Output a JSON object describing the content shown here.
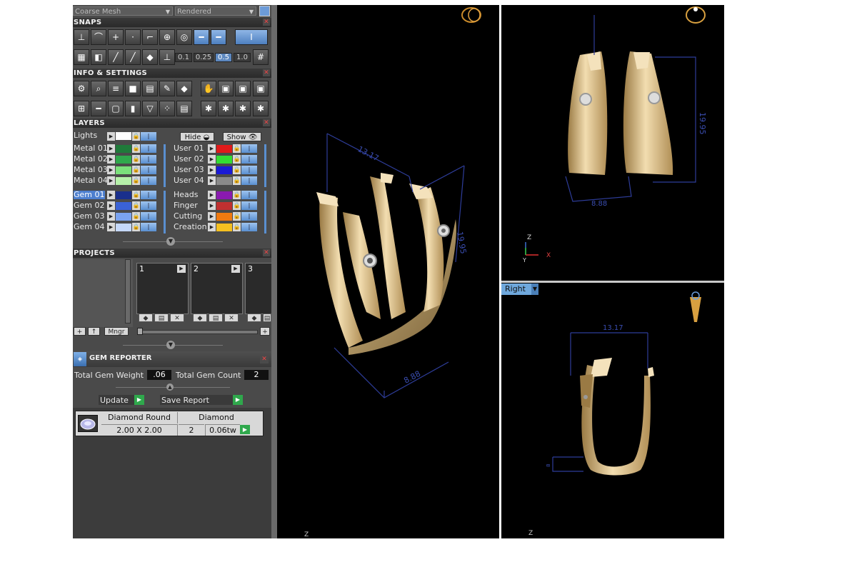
{
  "toolbar": {
    "mesh_mode": "Coarse Mesh",
    "render_mode": "Rendered"
  },
  "snaps": {
    "title": "SNAPS",
    "increments": [
      "0.1",
      "0.25",
      "0.5",
      "1.0"
    ],
    "selected_increment": "0.5"
  },
  "info_settings": {
    "title": "INFO & SETTINGS"
  },
  "layers": {
    "title": "LAYERS",
    "lights_label": "Lights",
    "hide_label": "Hide",
    "show_label": "Show",
    "left": [
      {
        "name": "Metal 01",
        "color": "#1f7a3a"
      },
      {
        "name": "Metal 02",
        "color": "#2fa84c"
      },
      {
        "name": "Metal 03",
        "color": "#7be07b"
      },
      {
        "name": "Metal 04",
        "color": "#b6f0a9"
      },
      {
        "name": "Gem 01",
        "color": "#1a2f8c",
        "selected": true
      },
      {
        "name": "Gem 02",
        "color": "#3a62d6"
      },
      {
        "name": "Gem 03",
        "color": "#7aa3f0"
      },
      {
        "name": "Gem 04",
        "color": "#c5d8fa"
      }
    ],
    "right": [
      {
        "name": "User 01",
        "color": "#e01a1a"
      },
      {
        "name": "User 02",
        "color": "#33dd33"
      },
      {
        "name": "User 03",
        "color": "#1a1ad6"
      },
      {
        "name": "User 04",
        "color": "#8a8a8a"
      },
      {
        "name": "Heads",
        "color": "#8a1ab0"
      },
      {
        "name": "Finger",
        "color": "#c03030"
      },
      {
        "name": "Cutting",
        "color": "#f07a10"
      },
      {
        "name": "Creation",
        "color": "#f5c020"
      }
    ],
    "lights_color": "#ffffff"
  },
  "projects": {
    "title": "PROJECTS",
    "slots": [
      "1",
      "2",
      "3"
    ],
    "add_label": "+",
    "up_label": "↑",
    "manager_label": "Mngr"
  },
  "gem_reporter": {
    "title": "GEM REPORTER",
    "total_weight_label": "Total Gem Weight",
    "total_weight_value": ".06",
    "total_count_label": "Total Gem Count",
    "total_count_value": "2",
    "update_label": "Update",
    "save_label": "Save Report",
    "gem": {
      "shape": "Diamond Round",
      "size": "2.00 X 2.00",
      "type": "Diamond",
      "count": "2",
      "weight": "0.06tw"
    }
  },
  "viewports": {
    "perspective": {
      "dim_width": "13.17",
      "dim_height": "19.95",
      "dim_depth": "8.88",
      "axis": "Z"
    },
    "front": {
      "dim_height": "19.95",
      "dim_width": "8.88",
      "axis_z": "Z",
      "axis_y": "Y",
      "axis_x": "X"
    },
    "right": {
      "label": "Right",
      "dim_top": "13.17",
      "dim_side": "8",
      "axis": "Z"
    }
  }
}
